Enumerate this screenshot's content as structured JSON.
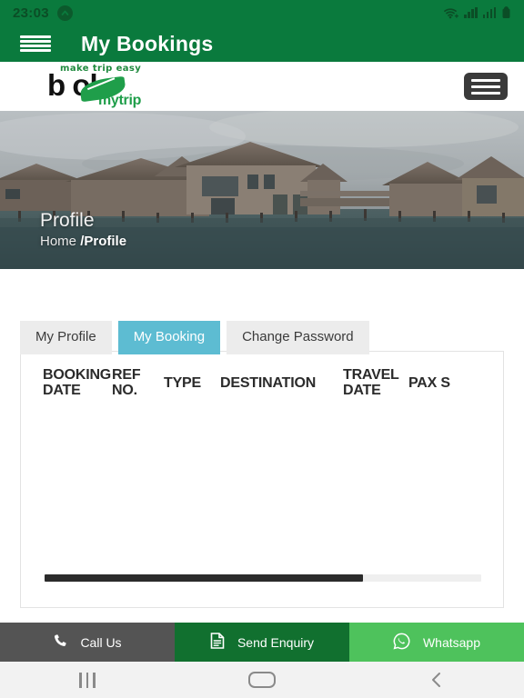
{
  "status_bar": {
    "time": "23:03",
    "badge_icon": "chevron-up-circle-icon",
    "wifi_icon": "wifi-plus-icon",
    "signal_icon_1": "signal-bars-icon",
    "signal_icon_2": "signal-bars-icon",
    "battery_icon": "battery-icon",
    "background_color": "#0a7a3d"
  },
  "app_bar": {
    "menu_icon": "hamburger-menu-icon",
    "title": "My Bookings",
    "background_color": "#0a7a3d"
  },
  "site_header": {
    "logo": {
      "tagline": "make trip easy",
      "wordmark": "b  ok",
      "subtext": "mytrip",
      "leaf_icon": "leaf-icon",
      "accent_color": "#1f9e4a"
    },
    "menu_toggle_icon": "hamburger-menu-icon"
  },
  "hero": {
    "image_alt": "overwater-bungalow-resort-photo",
    "title": "Profile",
    "breadcrumb_home": "Home",
    "breadcrumb_current": "/Profile"
  },
  "tabs": [
    {
      "label": "My Profile",
      "active": false
    },
    {
      "label": "My Booking",
      "active": true
    },
    {
      "label": "Change Password",
      "active": false
    }
  ],
  "tab_active_color": "#5dbcd2",
  "booking_table": {
    "columns": [
      "BOOKING\nDATE",
      "REF\nNO.",
      "TYPE",
      "DESTINATION",
      "TRAVEL\nDATE",
      "PAX S"
    ],
    "rows": [],
    "scroll_position_percent": 73
  },
  "action_bar": [
    {
      "label": "Call Us",
      "icon": "phone-icon",
      "color": "#545454"
    },
    {
      "label": "Send Enquiry",
      "icon": "document-icon",
      "color": "#11702f"
    },
    {
      "label": "Whatsapp",
      "icon": "whatsapp-icon",
      "color": "#4ec25c"
    }
  ],
  "android_nav": {
    "recents_icon": "recents-icon",
    "home_icon": "home-icon",
    "back_icon": "back-chevron-icon"
  }
}
